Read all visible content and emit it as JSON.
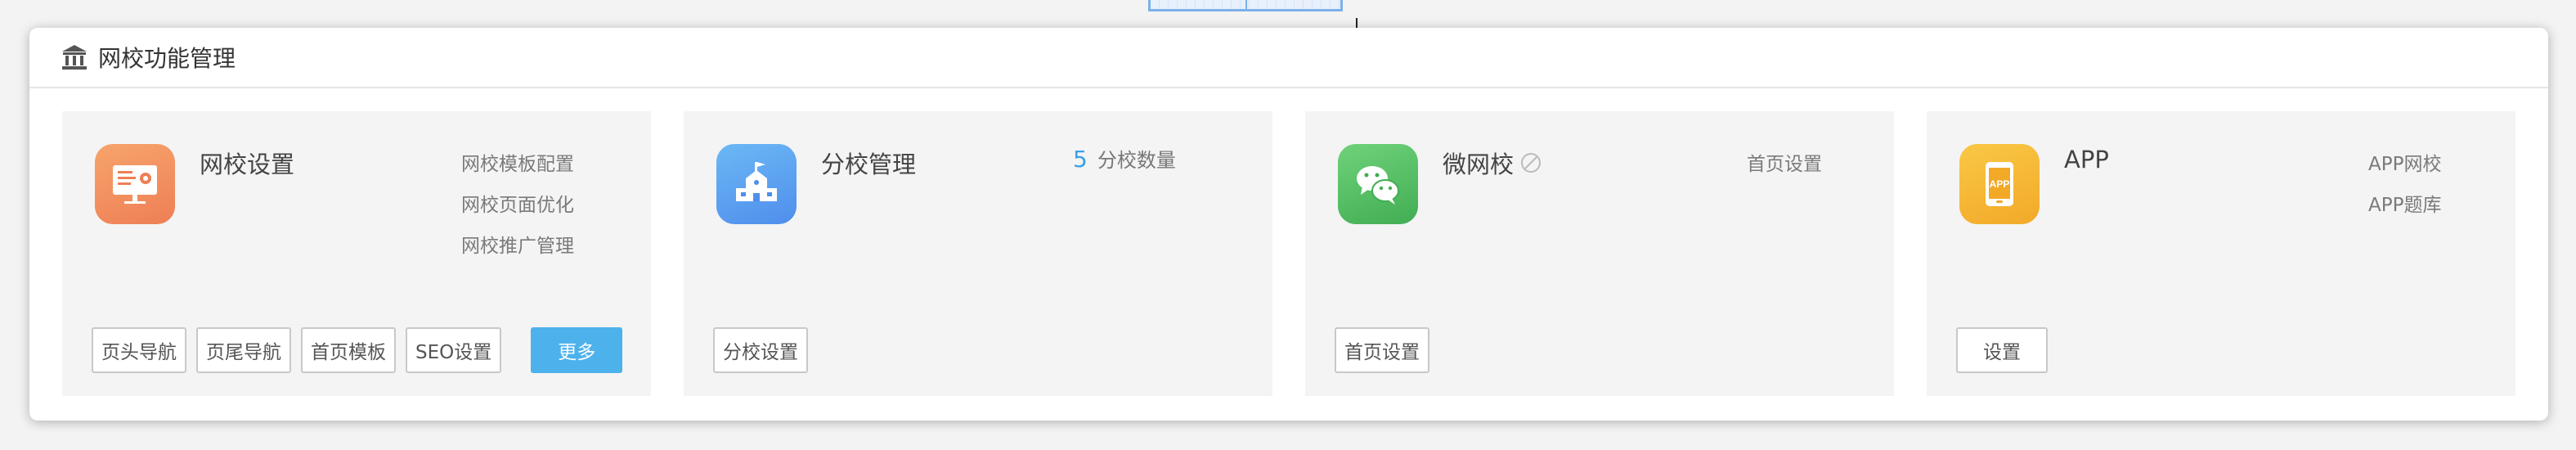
{
  "panel": {
    "title": "网校功能管理",
    "icon": "building-icon"
  },
  "cards": {
    "school": {
      "title": "网校设置",
      "icon": "certificate-icon",
      "icon_color": "#f0885e",
      "links": [
        "网校模板配置",
        "网校页面优化",
        "网校推广管理"
      ],
      "buttons": [
        "页头导航",
        "页尾导航",
        "首页模板",
        "SEO设置"
      ],
      "more_label": "更多"
    },
    "branch": {
      "title": "分校管理",
      "icon": "school-building-icon",
      "icon_color": "#4f96ee",
      "count": "5",
      "count_label": "分校数量",
      "buttons": [
        "分校设置"
      ]
    },
    "wechat": {
      "title": "微网校",
      "icon": "wechat-icon",
      "icon_color": "#4cba5e",
      "status_icon": "disabled-icon",
      "links": [
        "首页设置"
      ],
      "buttons": [
        "首页设置"
      ]
    },
    "app": {
      "title": "APP",
      "icon": "app-phone-icon",
      "icon_color": "#f5b733",
      "icon_text": "APP",
      "links": [
        "APP网校",
        "APP题库"
      ],
      "buttons": [
        "设置"
      ]
    }
  },
  "colors": {
    "accent": "#4db2ec",
    "count": "#3aa0e8"
  }
}
